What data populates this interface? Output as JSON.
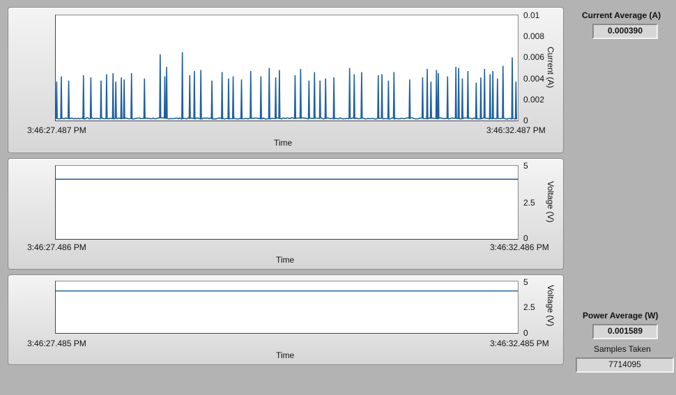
{
  "graphs": [
    {
      "y_axis_label": "Current (A)",
      "x_axis_label": "Time",
      "x_start": "3:46:27.487 PM",
      "x_end": "3:46:32.487 PM",
      "y_ticks": [
        "0.01",
        "0.008",
        "0.006",
        "0.004",
        "0.002",
        "0"
      ],
      "ylim": [
        0,
        0.01
      ],
      "color": "#1f5fa0"
    },
    {
      "y_axis_label": "Voltage (V)",
      "x_axis_label": "Time",
      "x_start": "3:46:27.486 PM",
      "x_end": "3:46:32.486 PM",
      "y_ticks": [
        "5",
        "2.5",
        "0"
      ],
      "ylim": [
        0,
        5
      ],
      "color": "#1f5fa0"
    },
    {
      "y_axis_label": "Voltage (V)",
      "x_axis_label": "Time",
      "x_start": "3:46:27.485 PM",
      "x_end": "3:46:32.485 PM",
      "y_ticks": [
        "5",
        "2.5",
        "0"
      ],
      "ylim": [
        0,
        5
      ],
      "color": "#1f5fa0"
    }
  ],
  "indicators": {
    "current_average": {
      "label": "Current Average (A)",
      "value": "0.000390"
    },
    "power_average": {
      "label": "Power Average (W)",
      "value": "0.001589"
    },
    "samples_taken": {
      "label": "Samples Taken",
      "value": "7714095"
    }
  },
  "chart_data": [
    {
      "type": "line",
      "xlabel": "Time",
      "ylabel": "Current (A)",
      "x_range": [
        "3:46:27.487 PM",
        "3:46:32.487 PM"
      ],
      "ylim": [
        0,
        0.01
      ],
      "baseline": 0.0002,
      "spike_times_s": [
        0.01,
        0.06,
        0.14,
        0.3,
        0.38,
        0.49,
        0.55,
        0.62,
        0.65,
        0.71,
        0.74,
        0.82,
        0.96,
        1.13,
        1.18,
        1.2,
        1.37,
        1.45,
        1.5,
        1.57,
        1.69,
        1.8,
        1.87,
        1.92,
        2.01,
        2.11,
        2.22,
        2.31,
        2.38,
        2.42,
        2.59,
        2.65,
        2.74,
        2.8,
        2.86,
        2.92,
        3.01,
        3.18,
        3.23,
        3.31,
        3.49,
        3.53,
        3.6,
        3.66,
        3.83,
        3.97,
        4.02,
        4.06,
        4.12,
        4.14,
        4.24,
        4.33,
        4.36,
        4.4,
        4.46,
        4.55,
        4.6,
        4.64,
        4.7,
        4.73,
        4.78,
        4.84,
        4.94,
        4.98
      ],
      "spike_peaks": [
        0.0037,
        0.0042,
        0.0038,
        0.0043,
        0.0041,
        0.0038,
        0.0044,
        0.0045,
        0.0037,
        0.0041,
        0.0039,
        0.0045,
        0.004,
        0.0063,
        0.0042,
        0.0051,
        0.0065,
        0.0043,
        0.0047,
        0.0048,
        0.0038,
        0.0046,
        0.004,
        0.0042,
        0.0039,
        0.0047,
        0.0042,
        0.005,
        0.0041,
        0.0048,
        0.0043,
        0.0049,
        0.0038,
        0.0046,
        0.0038,
        0.004,
        0.0041,
        0.005,
        0.0044,
        0.0046,
        0.0043,
        0.0044,
        0.0038,
        0.0046,
        0.0039,
        0.0041,
        0.0049,
        0.0037,
        0.0048,
        0.0045,
        0.0042,
        0.0051,
        0.005,
        0.004,
        0.0047,
        0.0036,
        0.0041,
        0.0049,
        0.0044,
        0.0047,
        0.004,
        0.0052,
        0.006,
        0.0037
      ]
    },
    {
      "type": "line",
      "xlabel": "Time",
      "ylabel": "Voltage (V)",
      "x_range": [
        "3:46:27.486 PM",
        "3:46:32.486 PM"
      ],
      "ylim": [
        0,
        5
      ],
      "values": [
        4.08,
        4.08
      ]
    },
    {
      "type": "line",
      "xlabel": "Time",
      "ylabel": "Voltage (V)",
      "x_range": [
        "3:46:27.485 PM",
        "3:46:32.485 PM"
      ],
      "ylim": [
        0,
        5
      ],
      "values": [
        4.08,
        4.08
      ]
    }
  ]
}
